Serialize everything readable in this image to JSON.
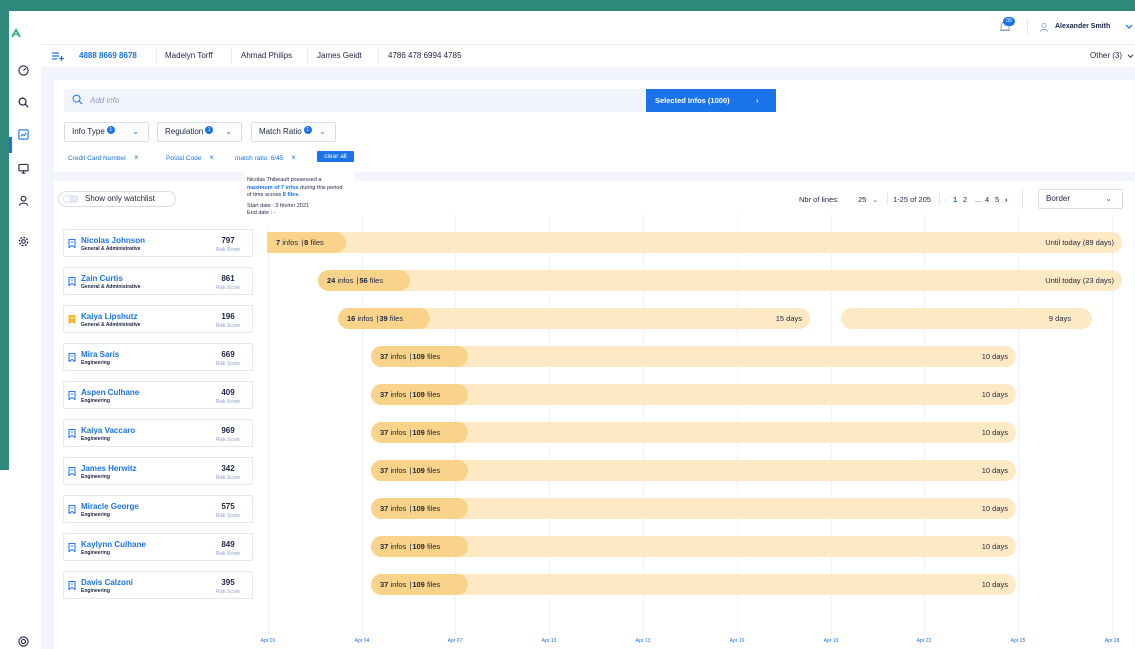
{
  "header": {
    "notification_count": "03",
    "user_name": "Alexander Smith"
  },
  "tabs": [
    "4888 8669 8678",
    "Madelyn Torff",
    "Ahmad Philips",
    "James Geidt",
    "4786 478 6994 4785"
  ],
  "tabs_other": "Other (3)",
  "search": {
    "placeholder": "Add info",
    "selected_button": "Selected Infos (1000)"
  },
  "filters": {
    "info_type": "Info Type",
    "info_type_count": "1",
    "regulation": "Regulation",
    "regulation_count": "1",
    "match_ratio": "Match Ratio",
    "match_ratio_count": "1"
  },
  "chips": [
    "Credit Card Number",
    "Postal Code",
    "match ratio: 6/45"
  ],
  "clear_all": "clear all",
  "tooltip": {
    "line1": "Nicolas Thibeault possessed a",
    "line2a": "maximum of 7 infos",
    "line2b": " during this period",
    "line3a": "of time across ",
    "line3b": "8 files",
    "line3c": ".",
    "start": "Start date : 3 février 2021",
    "end": "End date : -"
  },
  "watchlist_label": "Show only watchlist",
  "pagination": {
    "label": "Nbr of lines:",
    "per_page": "25",
    "range": "1-25 of 205",
    "pages": [
      "1",
      "2",
      "...",
      "4",
      "5"
    ]
  },
  "border_select": "Border",
  "risk_label": "Risk Score",
  "rows": [
    {
      "name": "Nicolas Johnson",
      "dept": "General & Administrative",
      "score": "797",
      "infos": "7",
      "files": "8",
      "duration": "Until today (89 days)",
      "watch": false
    },
    {
      "name": "Zain Curtis",
      "dept": "General & Administrative",
      "score": "861",
      "infos": "24",
      "files": "56",
      "duration": "Until today (23 days)",
      "watch": false
    },
    {
      "name": "Kaiya Lipshutz",
      "dept": "General & Administrative",
      "score": "196",
      "infos": "16",
      "files": "39",
      "duration": "15 days",
      "duration2": "9 days",
      "watch": true
    },
    {
      "name": "Mira Saris",
      "dept": "Engineering",
      "score": "669",
      "infos": "37",
      "files": "109",
      "duration": "10 days",
      "watch": false
    },
    {
      "name": "Aspen Culhane",
      "dept": "Engineering",
      "score": "409",
      "infos": "37",
      "files": "109",
      "duration": "10 days",
      "watch": false
    },
    {
      "name": "Kaiya Vaccaro",
      "dept": "Engineering",
      "score": "969",
      "infos": "37",
      "files": "109",
      "duration": "10 days",
      "watch": false
    },
    {
      "name": "James Herwitz",
      "dept": "Engineering",
      "score": "342",
      "infos": "37",
      "files": "109",
      "duration": "10 days",
      "watch": false
    },
    {
      "name": "Miracle George",
      "dept": "Engineering",
      "score": "575",
      "infos": "37",
      "files": "109",
      "duration": "10 days",
      "watch": false
    },
    {
      "name": "Kaylynn Culhane",
      "dept": "Engineering",
      "score": "849",
      "infos": "37",
      "files": "109",
      "duration": "10 days",
      "watch": false
    },
    {
      "name": "Davis Calzoni",
      "dept": "Engineering",
      "score": "395",
      "infos": "37",
      "files": "109",
      "duration": "10 days",
      "watch": false
    }
  ],
  "timeline_labels": [
    "Apr 01",
    "Apr 04",
    "Apr 07",
    "Apr 10",
    "Apr 13",
    "Apr 16",
    "Apr 19",
    "Apr 22",
    "Apr 25",
    "Apr 28"
  ],
  "colors": {
    "accent": "#1a73e8",
    "bar_light": "#fdeac4",
    "bar_dark": "#fad38a",
    "frame": "#2f8a7d",
    "watch_active": "#f5b82e"
  }
}
